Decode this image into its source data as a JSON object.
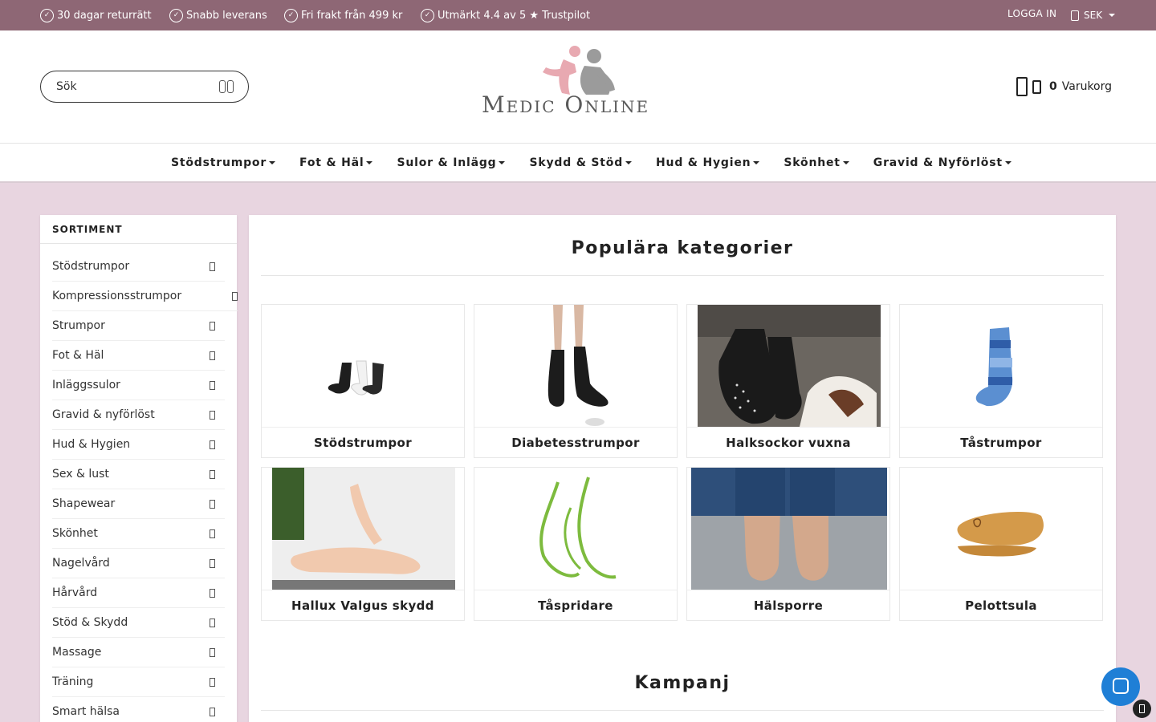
{
  "topbar": {
    "usps": [
      "30 dagar returrätt",
      "Snabb leverans",
      "Fri frakt från 499 kr",
      "Utmärkt 4.4 av 5 ★ Trustpilot"
    ],
    "login": "LOGGA IN",
    "currency": "SEK"
  },
  "header": {
    "search_placeholder": "Sök",
    "logo_text": "Medic Online",
    "cart_count": "0",
    "cart_label": "Varukorg"
  },
  "nav": [
    "Stödstrumpor",
    "Fot & Häl",
    "Sulor & Inlägg",
    "Skydd & Stöd",
    "Hud & Hygien",
    "Skönhet",
    "Gravid & Nyförlöst"
  ],
  "sidebar": {
    "title": "SORTIMENT",
    "items": [
      "Stödstrumpor",
      "Kompressionsstrumpor",
      "Strumpor",
      "Fot & Häl",
      "Inläggssulor",
      "Gravid & nyförlöst",
      "Hud & Hygien",
      "Sex & lust",
      "Shapewear",
      "Skönhet",
      "Nagelvård",
      "Hårvård",
      "Stöd & Skydd",
      "Massage",
      "Träning",
      "Smart hälsa"
    ]
  },
  "main": {
    "popular_title": "Populära kategorier",
    "categories": [
      "Stödstrumpor",
      "Diabetesstrumpor",
      "Halksockor vuxna",
      "Tåstrumpor",
      "Hallux Valgus skydd",
      "Tåspridare",
      "Hälsporre",
      "Pelottsula"
    ],
    "campaign_title": "Kampanj"
  },
  "colors": {
    "topbar": "#8e6775",
    "page_background": "#e8d5e0",
    "chat_button": "#1f7fd6"
  }
}
